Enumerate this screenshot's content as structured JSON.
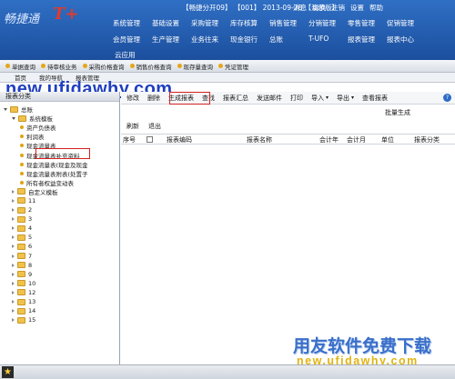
{
  "header": {
    "logo_text": "畅捷通",
    "logo_mark": "T+",
    "info": "【畅捷分开09】 【001】 2013-09-28 【演示版】",
    "actions": [
      "消息",
      "切换",
      "注销",
      "设置",
      "帮助"
    ],
    "menu_row1": [
      "系统管理",
      "基础设置",
      "采购管理",
      "库存核算",
      "销售管理",
      "分销管理",
      "零售管理",
      "促销管理"
    ],
    "menu_row2": [
      "会员管理",
      "生产管理",
      "业务往来",
      "现金银行",
      "总账",
      "T-UFO",
      "报表管理",
      "报表中心"
    ],
    "menu_row3": [
      "云应用"
    ]
  },
  "quickbar": [
    "单据查询",
    "待审核业务",
    "采购价格查询",
    "销售价格查询",
    "现存量查询",
    "凭证管理"
  ],
  "tabbar": [
    "首页",
    "我的导航",
    "报表管理"
  ],
  "watermark_top": "new.ufidawhy.com",
  "left_panel": {
    "title": "报表分类",
    "tree": [
      {
        "label": "总账",
        "type": "folder",
        "level": 0,
        "open": true
      },
      {
        "label": "系统模板",
        "type": "folder",
        "level": 1,
        "open": true
      },
      {
        "label": "资产负债表",
        "type": "leaf",
        "level": 2
      },
      {
        "label": "利润表",
        "type": "leaf",
        "level": 2
      },
      {
        "label": "现金流量表",
        "type": "leaf",
        "level": 2
      },
      {
        "label": "现金流量表补充资料",
        "type": "leaf",
        "level": 2
      },
      {
        "label": "现金流量表(现金及现金",
        "type": "leaf",
        "level": 2
      },
      {
        "label": "现金流量表附表(处置子",
        "type": "leaf",
        "level": 2
      },
      {
        "label": "所有者权益变动表",
        "type": "leaf",
        "level": 2
      },
      {
        "label": "自定义模板",
        "type": "folder",
        "level": 1,
        "open": false
      },
      {
        "label": "11",
        "type": "folder",
        "level": 1,
        "open": false
      },
      {
        "label": "2",
        "type": "folder",
        "level": 1,
        "open": false
      },
      {
        "label": "3",
        "type": "folder",
        "level": 1,
        "open": false
      },
      {
        "label": "4",
        "type": "folder",
        "level": 1,
        "open": false
      },
      {
        "label": "5",
        "type": "folder",
        "level": 1,
        "open": false
      },
      {
        "label": "6",
        "type": "folder",
        "level": 1,
        "open": false
      },
      {
        "label": "7",
        "type": "folder",
        "level": 1,
        "open": false
      },
      {
        "label": "8",
        "type": "folder",
        "level": 1,
        "open": false
      },
      {
        "label": "9",
        "type": "folder",
        "level": 1,
        "open": false
      },
      {
        "label": "10",
        "type": "folder",
        "level": 1,
        "open": false
      },
      {
        "label": "12",
        "type": "folder",
        "level": 1,
        "open": false
      },
      {
        "label": "13",
        "type": "folder",
        "level": 1,
        "open": false
      },
      {
        "label": "14",
        "type": "folder",
        "level": 1,
        "open": false
      },
      {
        "label": "15",
        "type": "folder",
        "level": 1,
        "open": false
      }
    ]
  },
  "toolbar": {
    "buttons": [
      {
        "label": "修改",
        "caret": false
      },
      {
        "label": "删除",
        "caret": false
      },
      {
        "label": "生成报表",
        "caret": false
      },
      {
        "label": "查找",
        "caret": false
      },
      {
        "label": "报表汇总",
        "caret": false
      },
      {
        "label": "发送邮件",
        "caret": false
      },
      {
        "label": "打印",
        "caret": false
      },
      {
        "label": "导入",
        "caret": true
      },
      {
        "label": "导出",
        "caret": true
      },
      {
        "label": "查看报表",
        "caret": false
      }
    ],
    "help": "?"
  },
  "row2": "批量生成",
  "row3": [
    "刷新",
    "退出"
  ],
  "columns": [
    "序号",
    "报表编码",
    "报表名称",
    "会计年",
    "会计月",
    "单位",
    "报表分类"
  ],
  "watermark_bottom": "用友软件免费下载",
  "watermark_bottom_url": "new.ufidawhy.com",
  "colors": {
    "header_blue": "#1c4f9e",
    "highlight_red": "#d42020",
    "folder_yellow": "#f0c24a"
  }
}
